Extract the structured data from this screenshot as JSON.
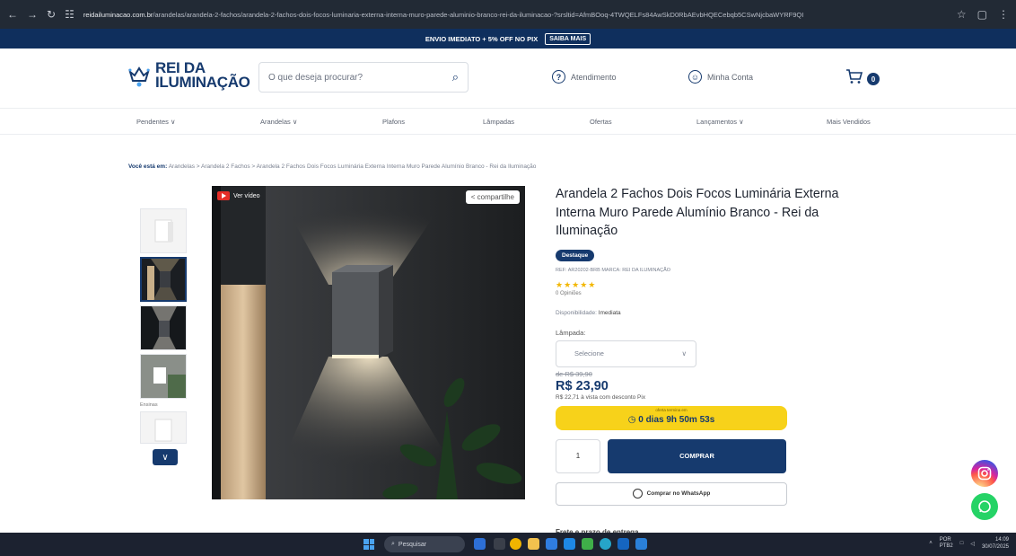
{
  "browser": {
    "back": "←",
    "forward": "→",
    "reload": "↻",
    "site_info": "☷",
    "url_domain": "reidailuminacao.com.br",
    "url_path": "/arandelas/arandela-2-fachos/arandela-2-fachos-dois-focos-luminaria-externa-interna-muro-parede-aluminio-branco-rei-da-iluminacao-?srsltid=AfmBOoq-4TWQELFs84AwSkD0RbAEvbHQECebqb5CSwNjcbaWYRF9QI",
    "star_icon": "☆",
    "extensions_icon": "▢",
    "menu_icon": "⋮"
  },
  "promo": {
    "text": "ENVIO IMEDIATO + 5% OFF NO PIX",
    "button": "SAIBA MAIS"
  },
  "header": {
    "logo_line1": "REI DA",
    "logo_line2": "ILUMINAÇÃO",
    "search_placeholder": "O que deseja procurar?",
    "search_icon": "⌕",
    "atendimento": "Atendimento",
    "atendimento_icon": "?",
    "minha_conta": "Minha Conta",
    "conta_icon": "☺",
    "cart_icon": "🛒",
    "cart_count": "0"
  },
  "menu": {
    "items": [
      "Pendentes ∨",
      "Arandelas ∨",
      "Plafons",
      "Lâmpadas",
      "Ofertas",
      "Lançamentos ∨",
      "Mais Vendidos"
    ]
  },
  "breadcrumb": {
    "prefix": "Você está em:",
    "path": "Arandelas  >  Arandela 2 Fachos  >  Arandela 2 Fachos Dois Focos Luminária Externa Interna Muro Parede Alumínio Branco - Rei da Iluminação"
  },
  "gallery": {
    "video_label": "Ver vídeo",
    "share_label": "compartilhe",
    "share_icon": "<",
    "thumb_caption": "Ensinas",
    "down_icon": "∨"
  },
  "product": {
    "title": "Arandela 2 Fachos Dois Focos Luminária Externa Interna Muro Parede Alumínio Branco - Rei da Iluminação",
    "badge": "Destaque",
    "meta": "REF: AR20202-BRB   MARCA: REI DA ILUMINAÇÃO",
    "stars": "★★★★★",
    "reviews": "0 Opiniões",
    "availability_label": "Disponibilidade:",
    "availability_value": "Imediata",
    "lamp_label": "Lâmpada:",
    "lamp_select": "Selecione",
    "select_icon": "∨",
    "old_price": "de R$ 39,90",
    "price": "R$ 23,90",
    "pix": "R$ 22,71 à vista com desconto Pix",
    "timer_caption": "oferta termina em",
    "timer": "◷ 0 dias  9h 50m 53s",
    "quantity": "1",
    "buy_button": "COMPRAR",
    "whatsapp_button": "Comprar no WhatsApp",
    "cut_text": "Frete e prazo de entrega"
  },
  "taskbar": {
    "search": "Pesquisar",
    "search_icon": "⌕",
    "lang": "POR",
    "lang2": "PTB2",
    "time": "14:09",
    "date": "30/07/2025",
    "chevron_icon": "˄",
    "network_icon": "□",
    "sound_icon": "◁"
  },
  "colors": {
    "brand": "#163a6e",
    "timer": "#f7d21a",
    "video": "#e52d27",
    "whatsapp": "#25d366"
  }
}
